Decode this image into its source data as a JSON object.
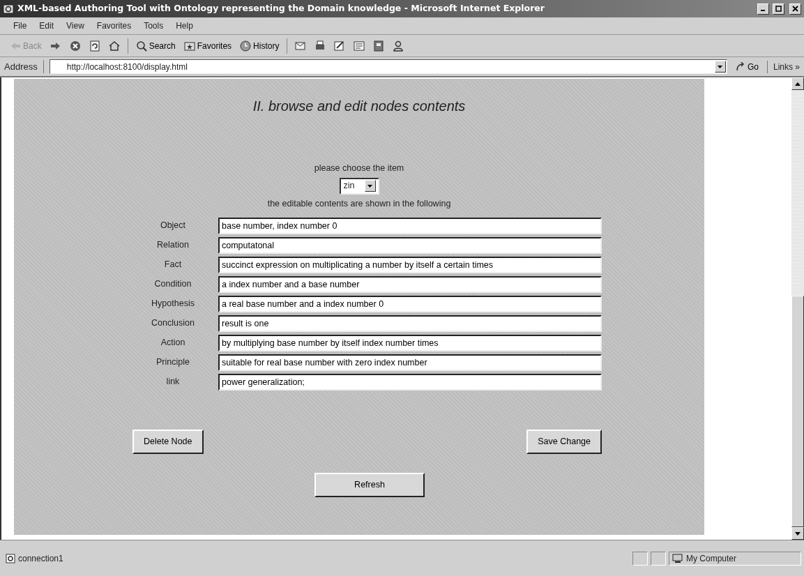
{
  "window": {
    "title": "XML-based Authoring Tool with Ontology representing the Domain knowledge - Microsoft Internet Explorer"
  },
  "menu_bar": [
    "File",
    "Edit",
    "View",
    "Favorites",
    "Tools",
    "Help"
  ],
  "toolbar": [
    {
      "kind": "back",
      "label": "Back",
      "disabled": true
    },
    {
      "kind": "forward",
      "disabled": false
    },
    {
      "kind": "stop",
      "disabled": false
    },
    {
      "kind": "refresh",
      "disabled": false
    },
    {
      "kind": "home",
      "disabled": false
    },
    {
      "kind": "search",
      "label": "Search",
      "disabled": false
    },
    {
      "kind": "favorites",
      "label": "Favorites",
      "disabled": false
    },
    {
      "kind": "history",
      "label": "History",
      "disabled": false
    },
    {
      "kind": "mail",
      "disabled": false
    },
    {
      "kind": "print",
      "disabled": false
    },
    {
      "kind": "edit",
      "disabled": false
    },
    {
      "kind": "discuss",
      "disabled": false
    },
    {
      "kind": "book",
      "disabled": false
    },
    {
      "kind": "messenger",
      "disabled": false
    }
  ],
  "address_bar": {
    "label": "Address",
    "value": "http://localhost:8100/display.html",
    "go": "Go",
    "links": "Links »"
  },
  "page": {
    "heading": "II. browse and edit nodes contents",
    "prompt": "please choose the item",
    "item_select": {
      "value": "zin"
    },
    "note": "the editable contents are shown in the following",
    "fields": [
      {
        "label": "Object",
        "value": "base number, index number 0"
      },
      {
        "label": "Relation",
        "value": "computatonal"
      },
      {
        "label": "Fact",
        "value": "succinct expression on multiplicating a number by itself a certain times"
      },
      {
        "label": "Condition",
        "value": "a index number and a base number"
      },
      {
        "label": "Hypothesis",
        "value": "a real base number and a index number 0"
      },
      {
        "label": "Conclusion",
        "value": "result is one"
      },
      {
        "label": "Action",
        "value": "by multiplying base number by itself index number times"
      },
      {
        "label": "Principle",
        "value": "suitable for real base number with zero index number"
      },
      {
        "label": "link",
        "value": "power generalization;"
      }
    ],
    "buttons": {
      "delete": "Delete Node",
      "save": "Save Change",
      "refresh": "Refresh"
    }
  },
  "status_bar": {
    "text": "connection1",
    "zone": "My Computer"
  }
}
